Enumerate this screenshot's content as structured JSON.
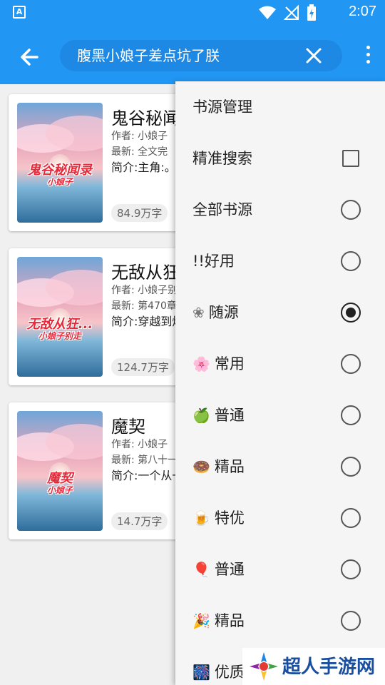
{
  "status_bar": {
    "time": "2:07",
    "notification_icon": "a-badge-icon",
    "icons": [
      "wifi-icon",
      "no-signal-icon",
      "battery-charging-icon"
    ]
  },
  "app_bar": {
    "back_icon": "arrow-left-icon",
    "search_query": "腹黑小娘子差点坑了朕",
    "clear_icon": "close-icon",
    "more_icon": "more-vert-icon"
  },
  "books": [
    {
      "title": "鬼谷秘闻",
      "cover_title": "鬼谷秘闻录",
      "cover_author": "小娘子",
      "author": "作者: 小娘子",
      "latest": "最新: 全文完",
      "intro": "简介:主角:。后留全尸的",
      "words": "84.9万字"
    },
    {
      "title": "无敌从狂",
      "cover_title": "无敌从狂...",
      "cover_author": "小娘子别走",
      "author": "作者: 小娘子别",
      "latest": "最新: 第470章",
      "intro": "简介:穿越到炼？不存在",
      "words": "124.7万字"
    },
    {
      "title": "魔契",
      "cover_title": "魔契",
      "cover_author": "小娘子",
      "author": "作者: 小娘子",
      "latest": "最新: 第八十一",
      "intro": "简介:一个从一个从小就",
      "words": "14.7万字"
    }
  ],
  "menu": {
    "header": "书源管理",
    "items": [
      {
        "label": "精准搜索",
        "control": "checkbox",
        "checked": false,
        "emoji": ""
      },
      {
        "label": "全部书源",
        "control": "radio",
        "checked": false,
        "emoji": ""
      },
      {
        "label": "!!好用",
        "control": "radio",
        "checked": false,
        "emoji": ""
      },
      {
        "label": "随源",
        "control": "radio",
        "checked": true,
        "emoji": "❀"
      },
      {
        "label": "常用",
        "control": "radio",
        "checked": false,
        "emoji": "🌸"
      },
      {
        "label": "普通",
        "control": "radio",
        "checked": false,
        "emoji": "🍏"
      },
      {
        "label": "精品",
        "control": "radio",
        "checked": false,
        "emoji": "🍩"
      },
      {
        "label": "特优",
        "control": "radio",
        "checked": false,
        "emoji": "🍺"
      },
      {
        "label": "普通",
        "control": "radio",
        "checked": false,
        "emoji": "🎈"
      },
      {
        "label": "精品",
        "control": "radio",
        "checked": false,
        "emoji": "🎉"
      },
      {
        "label": "优质",
        "control": "radio",
        "checked": false,
        "emoji": "🎆"
      }
    ]
  },
  "watermark": {
    "text": "超人手游网"
  }
}
